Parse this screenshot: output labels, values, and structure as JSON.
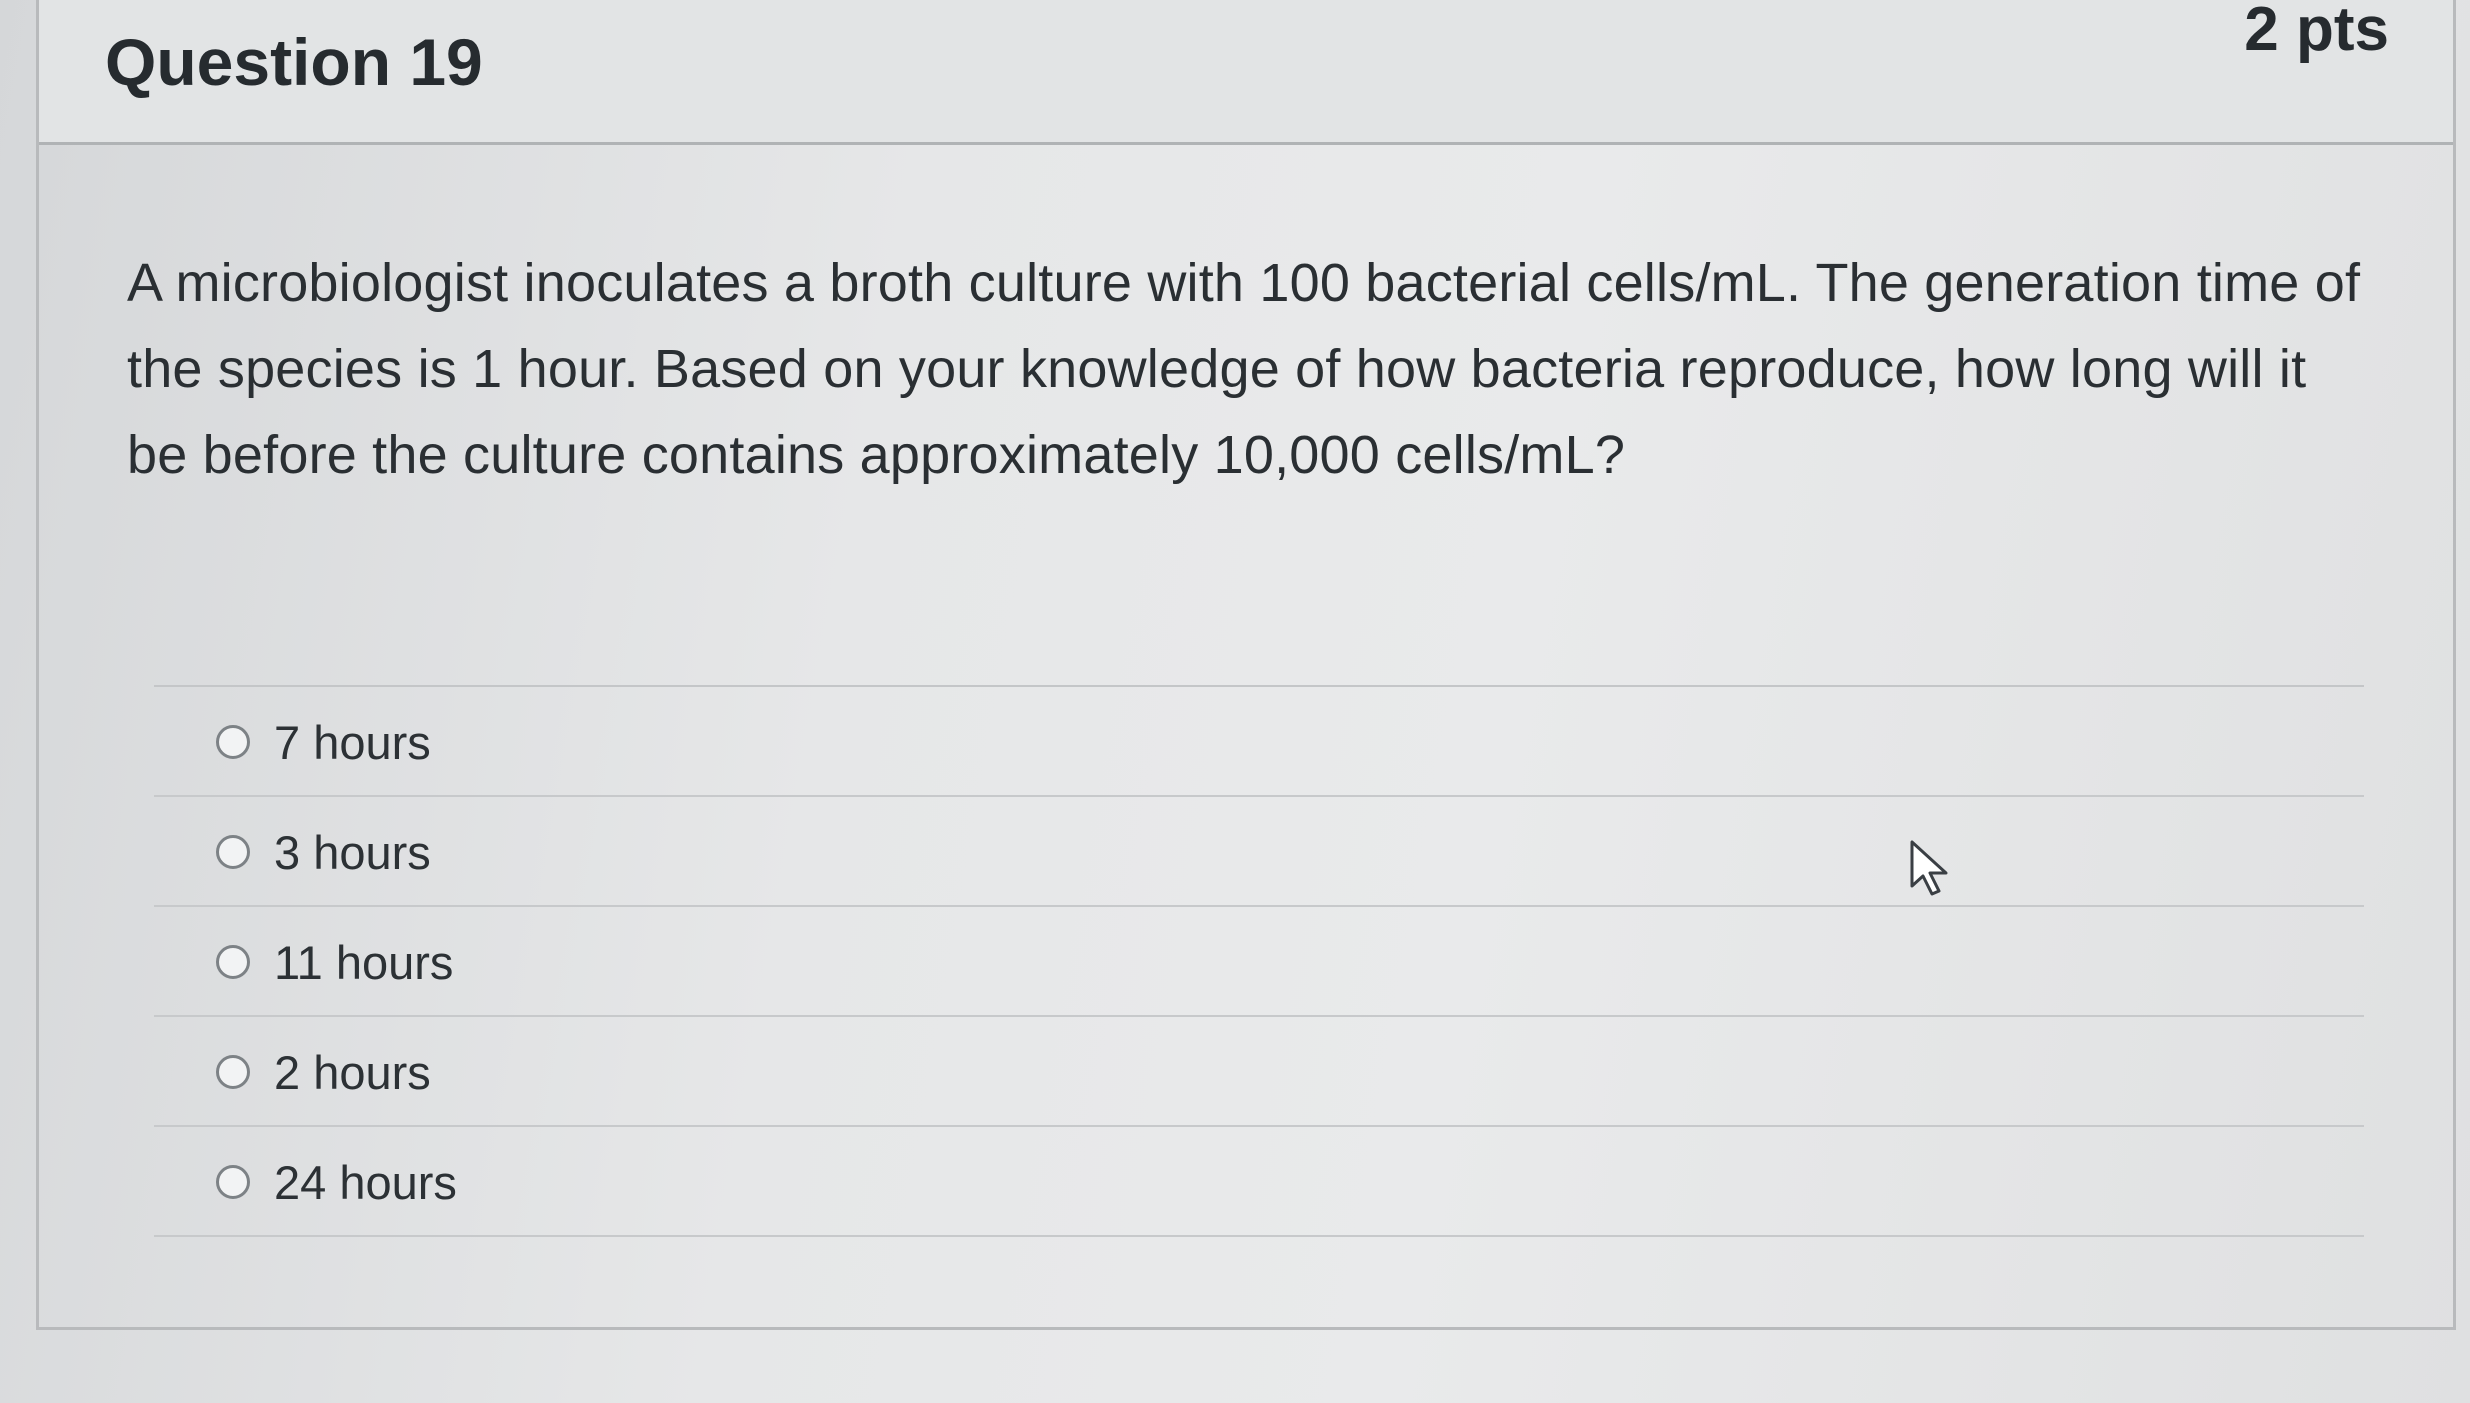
{
  "question": {
    "title": "Question 19",
    "points": "2 pts",
    "text": "A microbiologist inoculates a broth culture with 100 bacterial cells/mL. The generation time of the species is 1 hour. Based on your knowledge of how bacteria reproduce, how long will it be before the culture contains approximately 10,000 cells/mL?"
  },
  "answers": [
    {
      "label": "7 hours"
    },
    {
      "label": "3 hours"
    },
    {
      "label": "11 hours"
    },
    {
      "label": "2 hours"
    },
    {
      "label": "24 hours"
    }
  ],
  "icons": {
    "radio": "radio-button-icon",
    "cursor": "mouse-pointer-icon"
  }
}
